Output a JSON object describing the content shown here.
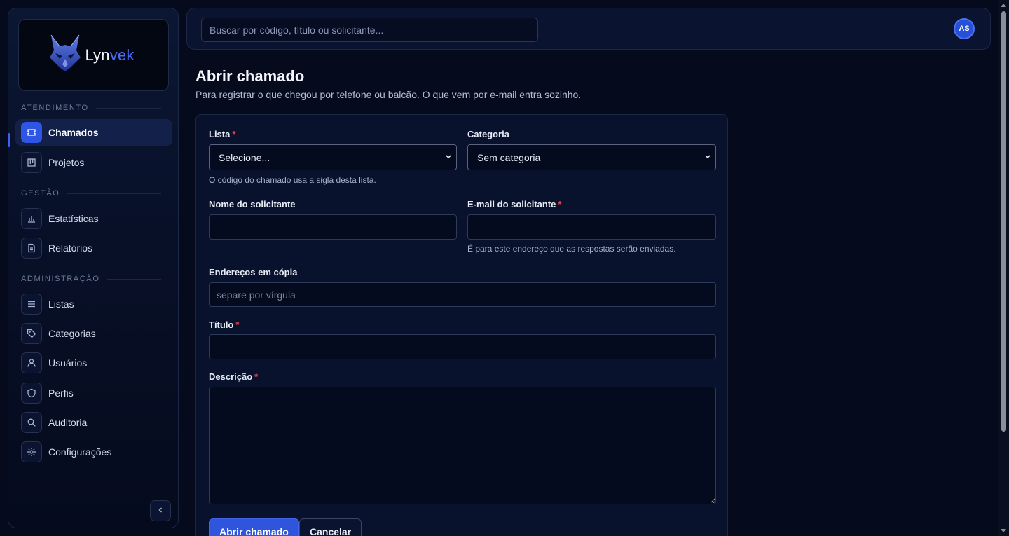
{
  "brand": {
    "name_part1": "Lyn",
    "name_part2": "vek",
    "logo_icon": "lynx-logo-icon"
  },
  "sidebar": {
    "sections": [
      {
        "label": "ATENDIMENTO"
      },
      {
        "label": "GESTÃO"
      },
      {
        "label": "ADMINISTRAÇÃO"
      }
    ],
    "items": [
      {
        "label": "Chamados",
        "icon": "ticket-icon",
        "active": true
      },
      {
        "label": "Projetos",
        "icon": "kanban-icon"
      },
      {
        "label": "Estatísticas",
        "icon": "bar-chart-icon"
      },
      {
        "label": "Relatórios",
        "icon": "document-icon"
      },
      {
        "label": "Listas",
        "icon": "list-icon"
      },
      {
        "label": "Categorias",
        "icon": "tag-icon"
      },
      {
        "label": "Usuários",
        "icon": "user-icon"
      },
      {
        "label": "Perfis",
        "icon": "shield-icon"
      },
      {
        "label": "Auditoria",
        "icon": "search-icon"
      },
      {
        "label": "Configurações",
        "icon": "gear-icon"
      }
    ],
    "collapse_icon": "chevron-left-icon"
  },
  "topbar": {
    "search_placeholder": "Buscar por código, título ou solicitante...",
    "avatar_initials": "AS"
  },
  "page": {
    "title": "Abrir chamado",
    "subtitle": "Para registrar o que chegou por telefone ou balcão. O que vem por e-mail entra sozinho."
  },
  "form": {
    "lista": {
      "label": "Lista",
      "required_mark": "*",
      "value": "Selecione...",
      "hint": "O código do chamado usa a sigla desta lista."
    },
    "categoria": {
      "label": "Categoria",
      "value": "Sem categoria"
    },
    "nome": {
      "label": "Nome do solicitante",
      "value": ""
    },
    "email": {
      "label": "E-mail do solicitante",
      "required_mark": "*",
      "value": "",
      "hint": "É para este endereço que as respostas serão enviadas."
    },
    "cc": {
      "label": "Endereços em cópia",
      "placeholder": "separe por vírgula"
    },
    "titulo": {
      "label": "Título",
      "required_mark": "*",
      "value": ""
    },
    "descricao": {
      "label": "Descrição",
      "required_mark": "*",
      "value": ""
    },
    "submit_label": "Abrir chamado",
    "cancel_label": "Cancelar"
  },
  "colors": {
    "accent": "#2e55dc",
    "background": "#050b1d",
    "required": "#ef4444"
  }
}
